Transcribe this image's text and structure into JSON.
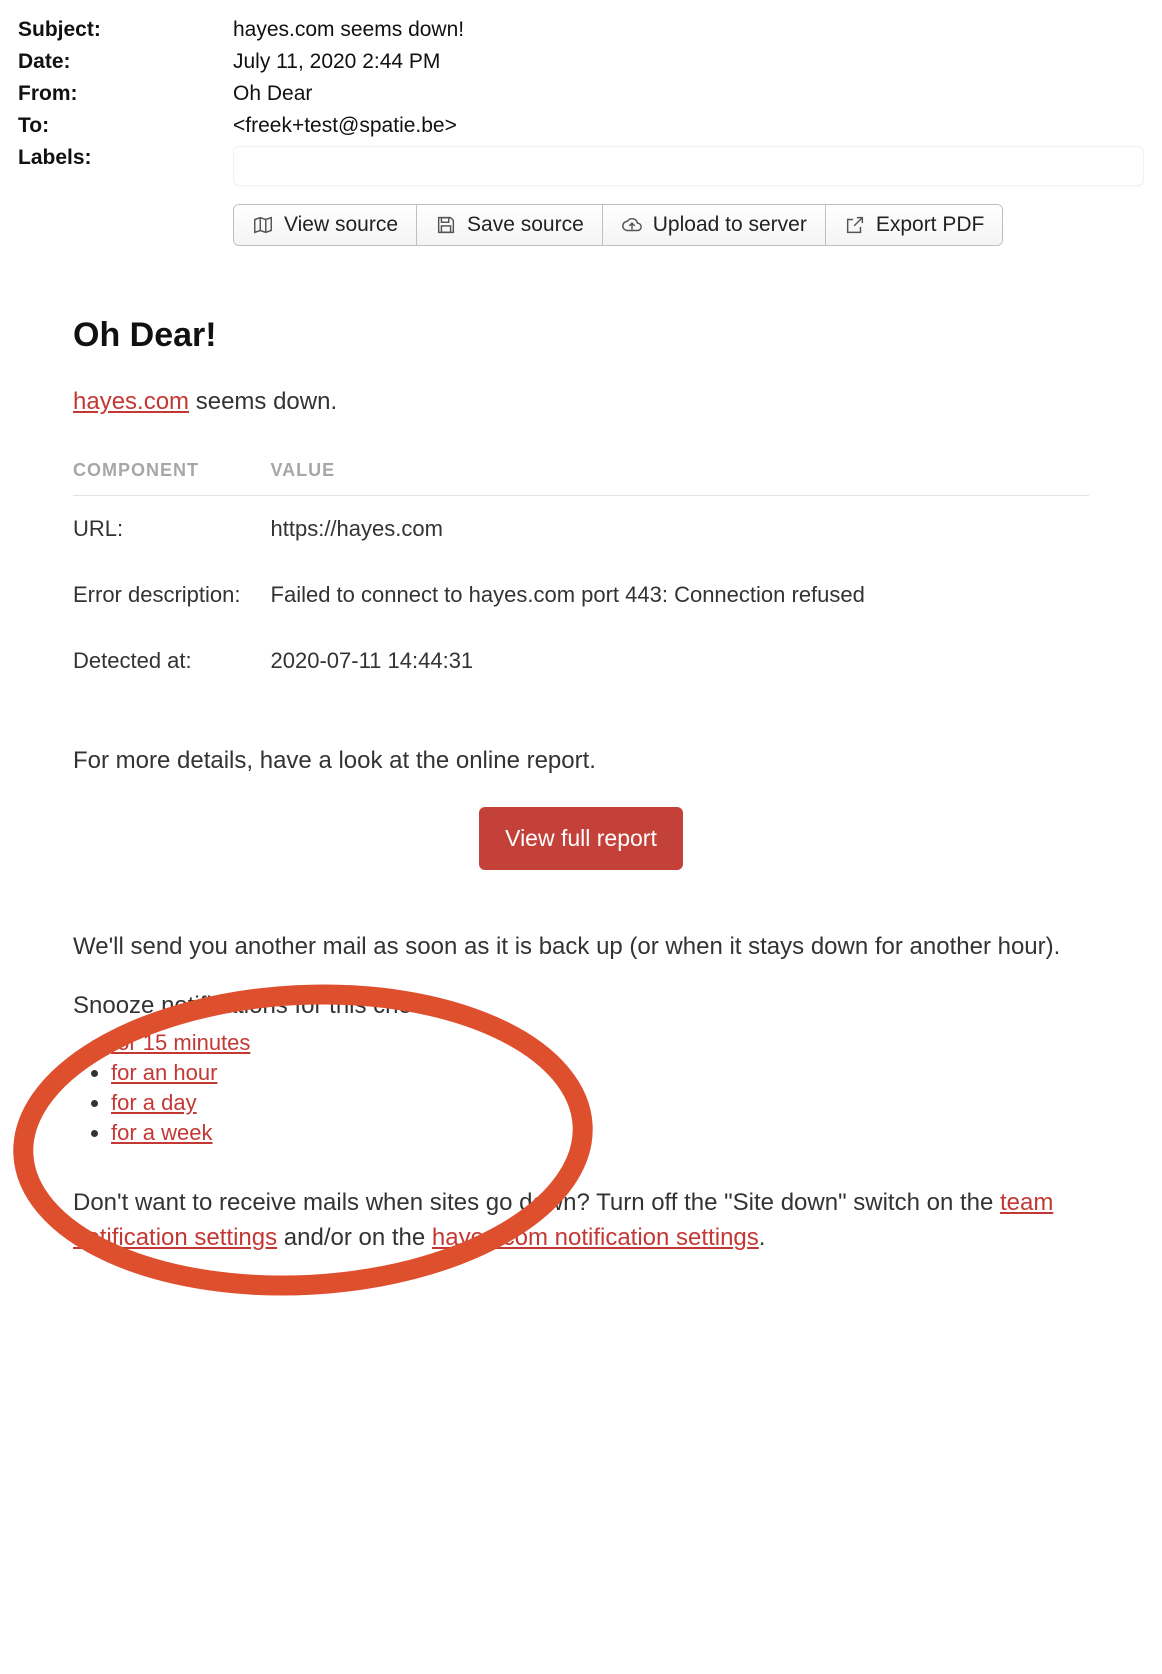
{
  "header": {
    "subject_k": "Subject:",
    "subject_v": "hayes.com seems down!",
    "date_k": "Date:",
    "date_v": "July 11, 2020 2:44 PM",
    "from_k": "From:",
    "from_v": "Oh Dear",
    "to_k": "To:",
    "to_v": "<freek+test@spatie.be>",
    "labels_k": "Labels:"
  },
  "toolbar": {
    "view_source": "View source",
    "save_source": "Save source",
    "upload": "Upload to server",
    "export": "Export PDF"
  },
  "mail": {
    "title": "Oh Dear!",
    "site_link": "hayes.com",
    "intro_rest": " seems down.",
    "component_h": "COMPONENT",
    "value_h": "VALUE",
    "rows": [
      {
        "k": "URL:",
        "v": "https://hayes.com"
      },
      {
        "k": "Error description:",
        "v": "Failed to connect to hayes.com port 443: Connection refused"
      },
      {
        "k": "Detected at:",
        "v": "2020-07-11 14:44:31"
      }
    ],
    "more_details": "For more details, have a look at the online report.",
    "full_report_btn": "View full report",
    "followup": "We'll send you another mail as soon as it is back up (or when it stays down for another hour).",
    "snooze_label": "Snooze notifications for this check:",
    "snooze_links": [
      "for 15 minutes",
      "for an hour",
      "for a day",
      "for a week"
    ],
    "footer_pre": "Don't want to receive mails when sites go down? Turn off the \"Site down\" switch on the ",
    "footer_link1": "team notification settings",
    "footer_mid": " and/or on the ",
    "footer_link2": "hayes.com notif­ication settings",
    "footer_post": "."
  }
}
